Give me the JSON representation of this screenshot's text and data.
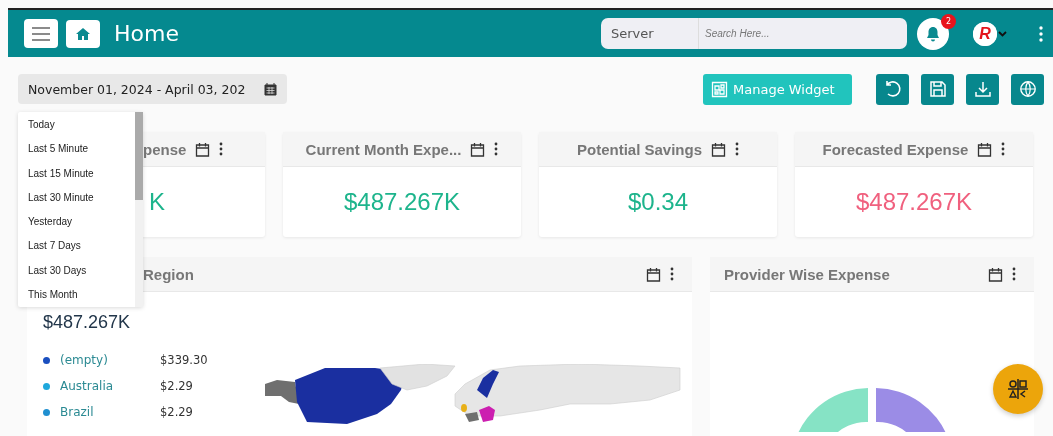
{
  "header": {
    "title": "Home",
    "search": {
      "scope": "Server",
      "placeholder": "Search Here..."
    },
    "notifications": {
      "count": "2"
    },
    "avatar_initial": "R"
  },
  "date_range": {
    "value": "November 01, 2024 - April 03, 202"
  },
  "date_menu": {
    "items": [
      {
        "label": "Today"
      },
      {
        "label": "Last 5 Minute"
      },
      {
        "label": "Last 15 Minute"
      },
      {
        "label": "Last 30 Minute"
      },
      {
        "label": "Yesterday"
      },
      {
        "label": "Last 7 Days"
      },
      {
        "label": "Last 30 Days"
      },
      {
        "label": "This Month"
      }
    ]
  },
  "toolbar": {
    "manage_widget": "Manage Widget"
  },
  "kpi_cards": [
    {
      "title": "pense",
      "value": "K",
      "color": "#1db48c"
    },
    {
      "title": "Current Month Expe...",
      "value": "$487.267K",
      "color": "#1db48c"
    },
    {
      "title": "Potential Savings",
      "value": "$0.34",
      "color": "#1db48c"
    },
    {
      "title": "Forecasted Expense",
      "value": "$487.267K",
      "color": "#f0607e"
    }
  ],
  "region_card": {
    "title": "Region",
    "total": "$487.267K",
    "legend": [
      {
        "name": "(empty)",
        "value": "$339.30",
        "color": "#1a4fbf"
      },
      {
        "name": "Australia",
        "value": "$2.29",
        "color": "#1fa8dc"
      },
      {
        "name": "Brazil",
        "value": "$2.29",
        "color": "#1f8fd0"
      }
    ]
  },
  "provider_card": {
    "title": "Provider Wise Expense"
  }
}
